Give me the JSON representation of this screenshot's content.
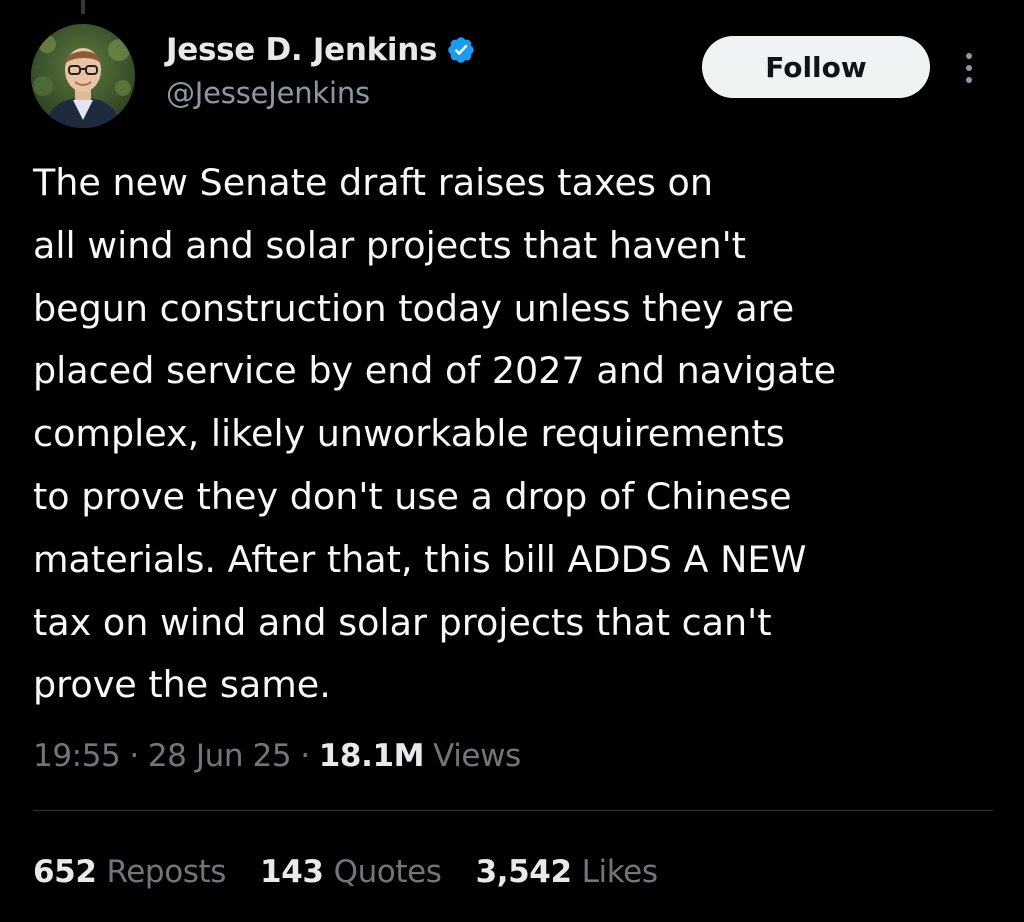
{
  "author": {
    "display_name": "Jesse D. Jenkins",
    "handle": "@JesseJenkins",
    "verified": true,
    "verified_color": "#1d9bf0"
  },
  "actions": {
    "follow_label": "Follow",
    "more_icon": "more-vertical-icon"
  },
  "tweet": {
    "text_lines": [
      "The new Senate draft raises taxes on",
      "all wind and solar projects that haven't",
      "begun construction today unless they are",
      "placed service by end of 2027 and navigate",
      "complex, likely unworkable requirements",
      "to prove they don't use a drop of Chinese",
      "materials. After that, this bill ADDS A NEW",
      "tax on wind and solar projects that can't",
      "prove the same."
    ]
  },
  "meta": {
    "time": "19:55",
    "separator": "·",
    "date": "28 Jun 25",
    "views_count": "18.1M",
    "views_label": "Views"
  },
  "stats": {
    "reposts_count": "652",
    "reposts_label": "Reposts",
    "quotes_count": "143",
    "quotes_label": "Quotes",
    "likes_count": "3,542",
    "likes_label": "Likes"
  },
  "colors": {
    "background": "#000000",
    "text_primary": "#e7e9ea",
    "text_secondary": "#71767b",
    "follow_button_bg": "#eff3f4"
  }
}
